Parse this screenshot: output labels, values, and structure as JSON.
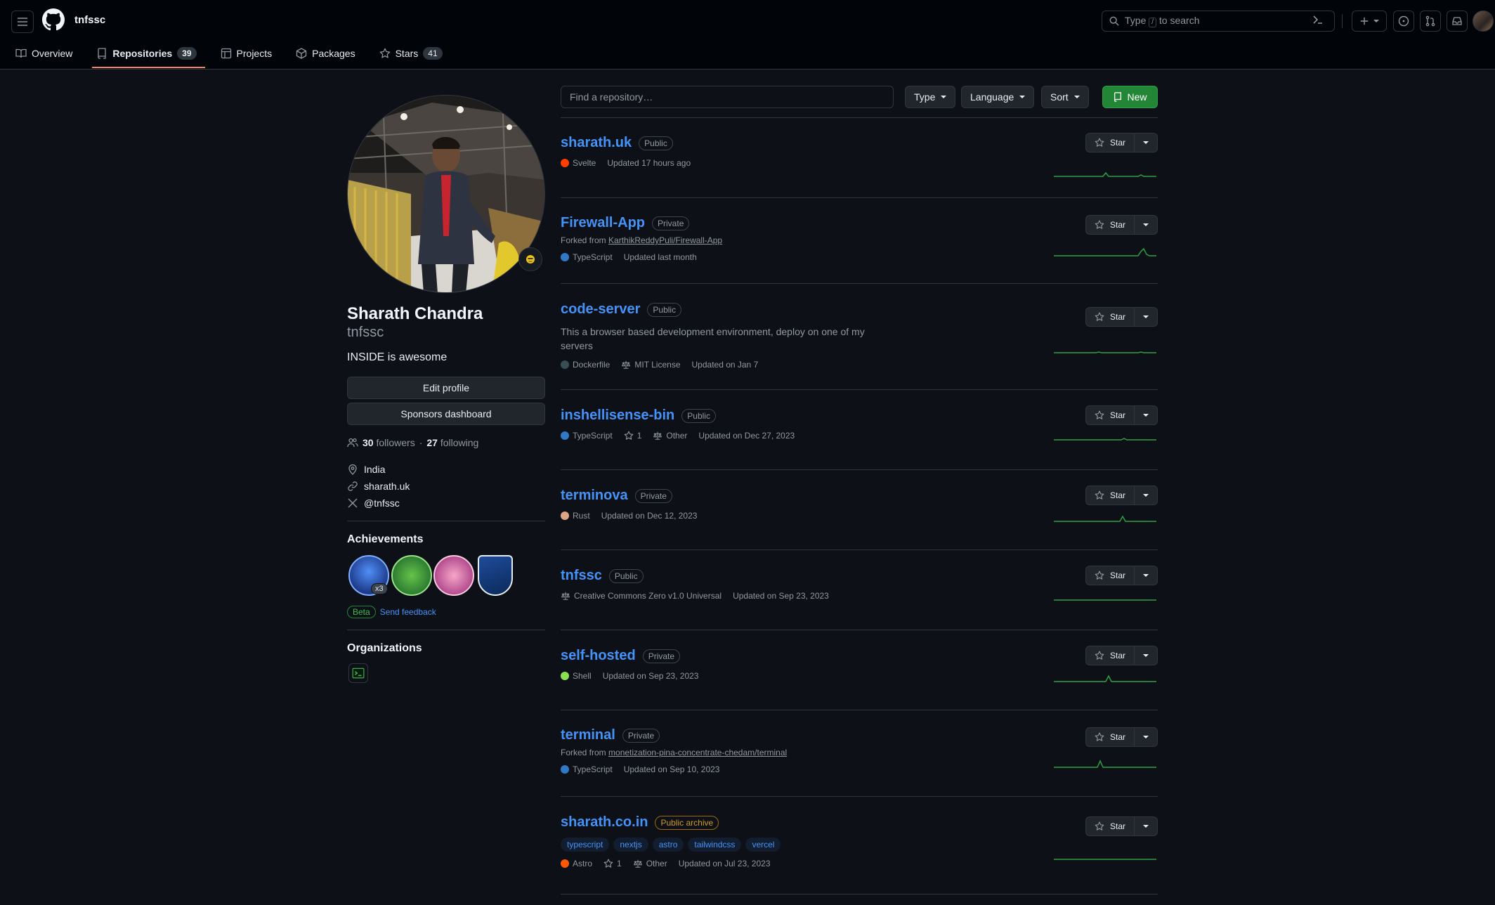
{
  "header": {
    "username": "tnfssc",
    "search": {
      "prefix": "Type",
      "key": "/",
      "suffix": "to search"
    },
    "nav_icons": [
      "hamburger-icon",
      "github-logo",
      "terminal-icon",
      "plus-icon",
      "issues-icon",
      "pull-requests-icon",
      "inbox-icon"
    ]
  },
  "tabs": [
    {
      "label": "Overview",
      "icon": "book-icon"
    },
    {
      "label": "Repositories",
      "count": "39",
      "icon": "repo-icon",
      "active": true
    },
    {
      "label": "Projects",
      "icon": "table-icon"
    },
    {
      "label": "Packages",
      "icon": "package-icon"
    },
    {
      "label": "Stars",
      "count": "41",
      "icon": "star-icon"
    }
  ],
  "profile": {
    "full_name": "Sharath Chandra",
    "login": "tnfssc",
    "bio": "INSIDE is awesome",
    "edit_button": "Edit profile",
    "sponsors_button": "Sponsors dashboard",
    "followers_count": "30",
    "followers_label": "followers",
    "dot": "·",
    "following_count": "27",
    "following_label": "following",
    "location": "India",
    "website": "sharath.uk",
    "twitter": "@tnfssc",
    "achievements_title": "Achievements",
    "achievement_multiplier": "x3",
    "beta_label": "Beta",
    "feedback_label": "Send feedback",
    "organizations_title": "Organizations"
  },
  "filters": {
    "find_placeholder": "Find a repository…",
    "type": "Type",
    "language": "Language",
    "sort": "Sort",
    "new": "New"
  },
  "colors": {
    "accent_link": "#4493f8",
    "new_button": "#238636",
    "tab_underline": "#f78166",
    "spark": "#2ea043"
  },
  "star_label": "Star",
  "repos": [
    {
      "name": "sharath.uk",
      "visibility": "Public",
      "language": "Svelte",
      "lang_color": "#ff3e00",
      "updated": "Updated 17 hours ago"
    },
    {
      "name": "Firewall-App",
      "visibility": "Private",
      "forked_prefix": "Forked from",
      "forked_from": "KarthikReddyPuli/Firewall-App",
      "language": "TypeScript",
      "lang_color": "#3178c6",
      "updated": "Updated last month"
    },
    {
      "name": "code-server",
      "visibility": "Public",
      "description": "This a browser based development environment, deploy on one of my servers",
      "language": "Dockerfile",
      "lang_color": "#384d54",
      "license": "MIT License",
      "updated": "Updated on Jan 7"
    },
    {
      "name": "inshellisense-bin",
      "visibility": "Public",
      "language": "TypeScript",
      "lang_color": "#3178c6",
      "stars": "1",
      "license": "Other",
      "updated": "Updated on Dec 27, 2023"
    },
    {
      "name": "terminova",
      "visibility": "Private",
      "language": "Rust",
      "lang_color": "#dea584",
      "updated": "Updated on Dec 12, 2023"
    },
    {
      "name": "tnfssc",
      "visibility": "Public",
      "license": "Creative Commons Zero v1.0 Universal",
      "updated": "Updated on Sep 23, 2023"
    },
    {
      "name": "self-hosted",
      "visibility": "Private",
      "language": "Shell",
      "lang_color": "#89e051",
      "updated": "Updated on Sep 23, 2023"
    },
    {
      "name": "terminal",
      "visibility": "Private",
      "forked_prefix": "Forked from",
      "forked_from": "monetization-pina-concentrate-chedam/terminal",
      "language": "TypeScript",
      "lang_color": "#3178c6",
      "updated": "Updated on Sep 10, 2023"
    },
    {
      "name": "sharath.co.in",
      "visibility": "Public archive",
      "topics": [
        "typescript",
        "nextjs",
        "astro",
        "tailwindcss",
        "vercel"
      ],
      "language": "Astro",
      "lang_color": "#ff5a03",
      "stars": "1",
      "license": "Other",
      "updated": "Updated on Jul 23, 2023"
    }
  ]
}
